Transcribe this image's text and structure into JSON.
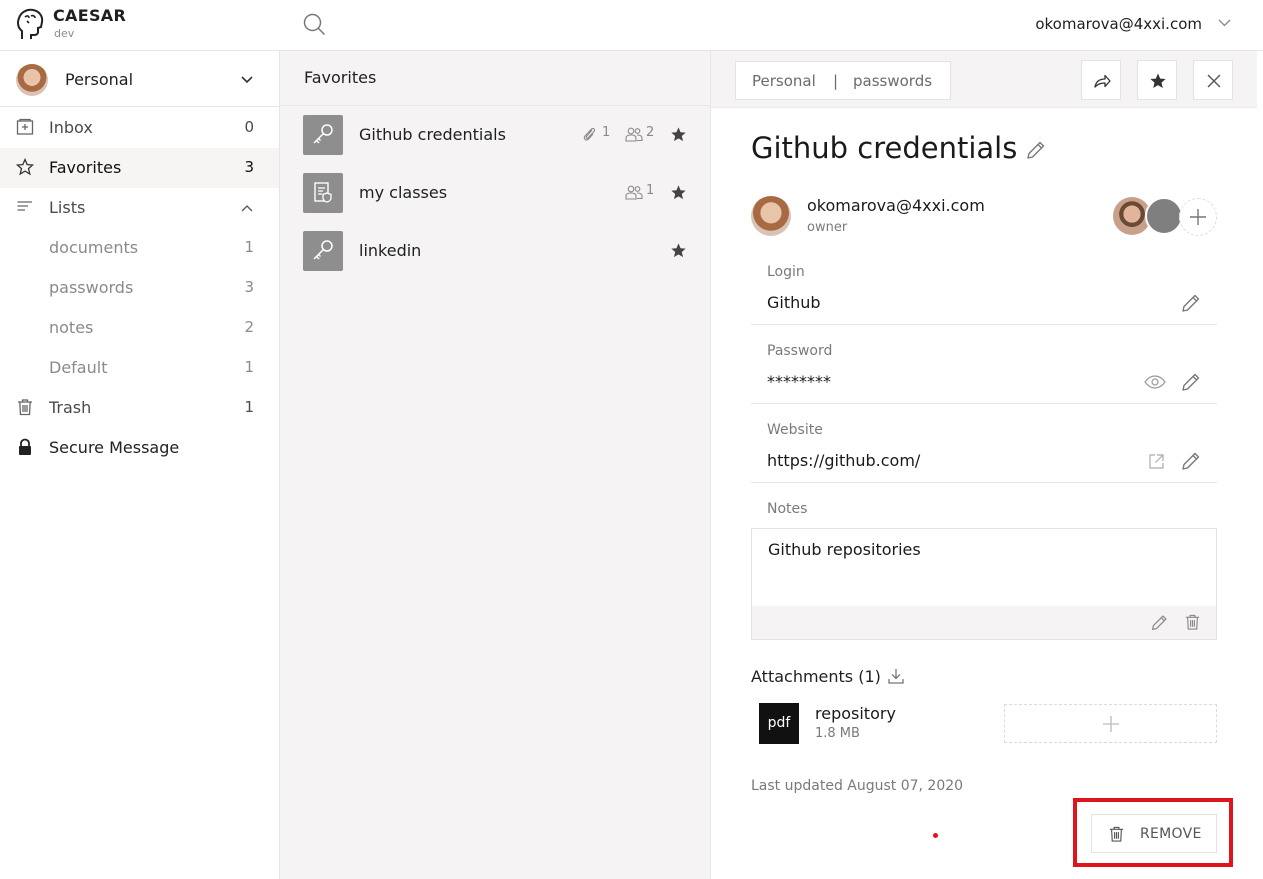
{
  "app": {
    "name": "CAESAR",
    "env": "dev"
  },
  "header": {
    "user_email": "okomarova@4xxi.com"
  },
  "sidebar": {
    "account": "Personal",
    "items": [
      {
        "label": "Inbox",
        "count": "0"
      },
      {
        "label": "Favorites",
        "count": "3"
      },
      {
        "label": "Lists",
        "count": ""
      },
      {
        "label": "documents",
        "count": "1"
      },
      {
        "label": "passwords",
        "count": "3"
      },
      {
        "label": "notes",
        "count": "2"
      },
      {
        "label": "Default",
        "count": "1"
      },
      {
        "label": "Trash",
        "count": "1"
      },
      {
        "label": "Secure Message",
        "count": ""
      }
    ]
  },
  "list": {
    "title": "Favorites",
    "items": [
      {
        "name": "Github credentials",
        "attachments": "1",
        "shares": "2"
      },
      {
        "name": "my classes",
        "attachments": "",
        "shares": "1"
      },
      {
        "name": "linkedin",
        "attachments": "",
        "shares": ""
      }
    ]
  },
  "detail": {
    "breadcrumb": {
      "account": "Personal",
      "sep": "|",
      "list": "passwords"
    },
    "title": "Github credentials",
    "owner": {
      "email": "okomarova@4xxi.com",
      "role": "owner"
    },
    "fields": {
      "login_label": "Login",
      "login_value": "Github",
      "password_label": "Password",
      "password_value": "********",
      "website_label": "Website",
      "website_value": "https://github.com/",
      "notes_label": "Notes",
      "notes_value": "Github repositories"
    },
    "attachments": {
      "title": "Attachments (1)",
      "file": {
        "type": "pdf",
        "name": "repository",
        "size": "1.8 MB"
      }
    },
    "last_updated": "Last updated August 07, 2020",
    "remove_label": "REMOVE"
  },
  "colors": {
    "highlight": "#e0141b",
    "icon_bg": "#8e8e8e",
    "panel_bg": "#f5f3f3"
  }
}
